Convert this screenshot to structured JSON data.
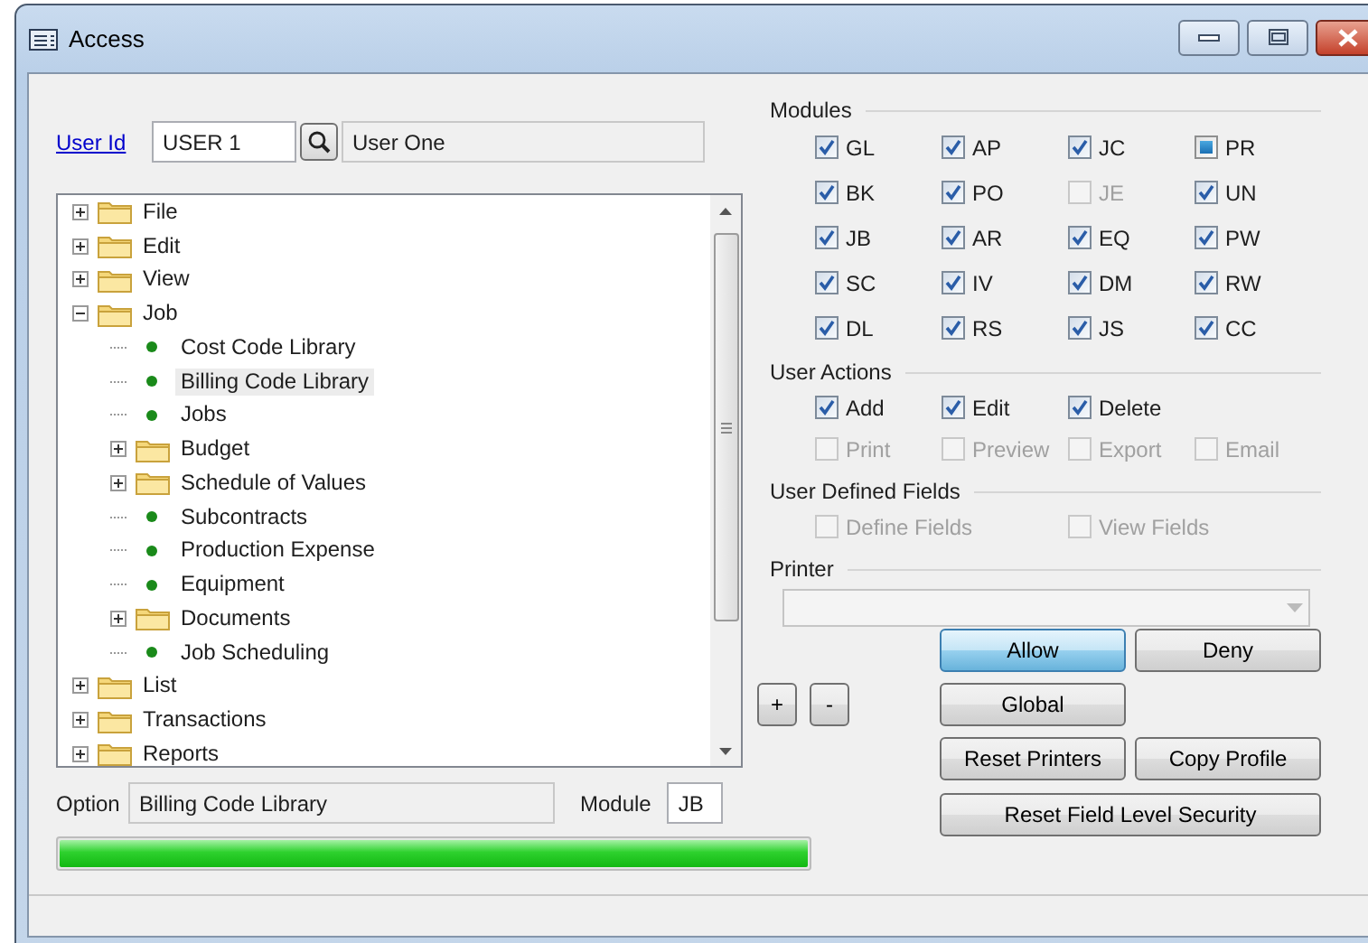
{
  "window": {
    "title": "Access"
  },
  "user": {
    "label": "User Id",
    "id": "USER 1",
    "name": "User One"
  },
  "tree": {
    "items": [
      {
        "label": "File",
        "kind": "folder",
        "expanded": false,
        "selected": false
      },
      {
        "label": "Edit",
        "kind": "folder",
        "expanded": false,
        "selected": false
      },
      {
        "label": "View",
        "kind": "folder",
        "expanded": false,
        "selected": false
      },
      {
        "label": "Job",
        "kind": "folder",
        "expanded": true,
        "selected": false,
        "children": [
          {
            "label": "Cost Code Library",
            "kind": "item",
            "selected": false
          },
          {
            "label": "Billing Code Library",
            "kind": "item",
            "selected": true
          },
          {
            "label": "Jobs",
            "kind": "item",
            "selected": false
          },
          {
            "label": "Budget",
            "kind": "folder",
            "expanded": false,
            "selected": false
          },
          {
            "label": "Schedule of Values",
            "kind": "folder",
            "expanded": false,
            "selected": false
          },
          {
            "label": "Subcontracts",
            "kind": "item",
            "selected": false
          },
          {
            "label": "Production Expense",
            "kind": "item",
            "selected": false
          },
          {
            "label": "Equipment",
            "kind": "item",
            "selected": false
          },
          {
            "label": "Documents",
            "kind": "folder",
            "expanded": false,
            "selected": false
          },
          {
            "label": "Job Scheduling",
            "kind": "item",
            "selected": false
          }
        ]
      },
      {
        "label": "List",
        "kind": "folder",
        "expanded": false,
        "selected": false
      },
      {
        "label": "Transactions",
        "kind": "folder",
        "expanded": false,
        "selected": false
      },
      {
        "label": "Reports",
        "kind": "folder",
        "expanded": false,
        "selected": false
      }
    ]
  },
  "option": {
    "label": "Option",
    "value": "Billing Code Library"
  },
  "module": {
    "label": "Module",
    "value": "JB"
  },
  "progress": {
    "level": 1
  },
  "modules": {
    "title": "Modules",
    "rows": [
      [
        {
          "label": "GL",
          "checked": true,
          "mixed": false,
          "disabled": false
        },
        {
          "label": "AP",
          "checked": true,
          "mixed": false,
          "disabled": false
        },
        {
          "label": "JC",
          "checked": true,
          "mixed": false,
          "disabled": false
        },
        {
          "label": "PR",
          "checked": false,
          "mixed": true,
          "disabled": false
        }
      ],
      [
        {
          "label": "BK",
          "checked": true,
          "mixed": false,
          "disabled": false
        },
        {
          "label": "PO",
          "checked": true,
          "mixed": false,
          "disabled": false
        },
        {
          "label": "JE",
          "checked": false,
          "mixed": false,
          "disabled": true
        },
        {
          "label": "UN",
          "checked": true,
          "mixed": false,
          "disabled": false
        }
      ],
      [
        {
          "label": "JB",
          "checked": true,
          "mixed": false,
          "disabled": false
        },
        {
          "label": "AR",
          "checked": true,
          "mixed": false,
          "disabled": false
        },
        {
          "label": "EQ",
          "checked": true,
          "mixed": false,
          "disabled": false
        },
        {
          "label": "PW",
          "checked": true,
          "mixed": false,
          "disabled": false
        }
      ],
      [
        {
          "label": "SC",
          "checked": true,
          "mixed": false,
          "disabled": false
        },
        {
          "label": "IV",
          "checked": true,
          "mixed": false,
          "disabled": false
        },
        {
          "label": "DM",
          "checked": true,
          "mixed": false,
          "disabled": false
        },
        {
          "label": "RW",
          "checked": true,
          "mixed": false,
          "disabled": false
        }
      ],
      [
        {
          "label": "DL",
          "checked": true,
          "mixed": false,
          "disabled": false
        },
        {
          "label": "RS",
          "checked": true,
          "mixed": false,
          "disabled": false
        },
        {
          "label": "JS",
          "checked": true,
          "mixed": false,
          "disabled": false
        },
        {
          "label": "CC",
          "checked": true,
          "mixed": false,
          "disabled": false
        }
      ]
    ]
  },
  "user_actions": {
    "title": "User Actions",
    "rows": [
      [
        {
          "label": "Add",
          "checked": true,
          "mixed": false,
          "disabled": false
        },
        {
          "label": "Edit",
          "checked": true,
          "mixed": false,
          "disabled": false
        },
        {
          "label": "Delete",
          "checked": true,
          "mixed": false,
          "disabled": false
        }
      ],
      [
        {
          "label": "Print",
          "checked": false,
          "mixed": false,
          "disabled": true
        },
        {
          "label": "Preview",
          "checked": false,
          "mixed": false,
          "disabled": true
        },
        {
          "label": "Export",
          "checked": false,
          "mixed": false,
          "disabled": true
        },
        {
          "label": "Email",
          "checked": false,
          "mixed": false,
          "disabled": true
        }
      ]
    ]
  },
  "user_defined_fields": {
    "title": "User Defined Fields",
    "rows": [
      [
        {
          "label": "Define Fields",
          "checked": false,
          "mixed": false,
          "disabled": true
        },
        {
          "label": "View Fields",
          "checked": false,
          "mixed": false,
          "disabled": true
        }
      ]
    ]
  },
  "printer": {
    "title": "Printer"
  },
  "buttons": {
    "allow": {
      "label": "Allow",
      "default": true
    },
    "deny": {
      "label": "Deny",
      "default": false
    },
    "add": {
      "label": "+",
      "default": false
    },
    "remove": {
      "label": "-",
      "default": false
    },
    "global": {
      "label": "Global",
      "default": false
    },
    "reset_printers": {
      "label": "Reset Printers",
      "default": false
    },
    "copy_profile": {
      "label": "Copy Profile",
      "default": false
    },
    "reset_field_level_security": {
      "label": "Reset Field Level Security",
      "default": false
    }
  }
}
